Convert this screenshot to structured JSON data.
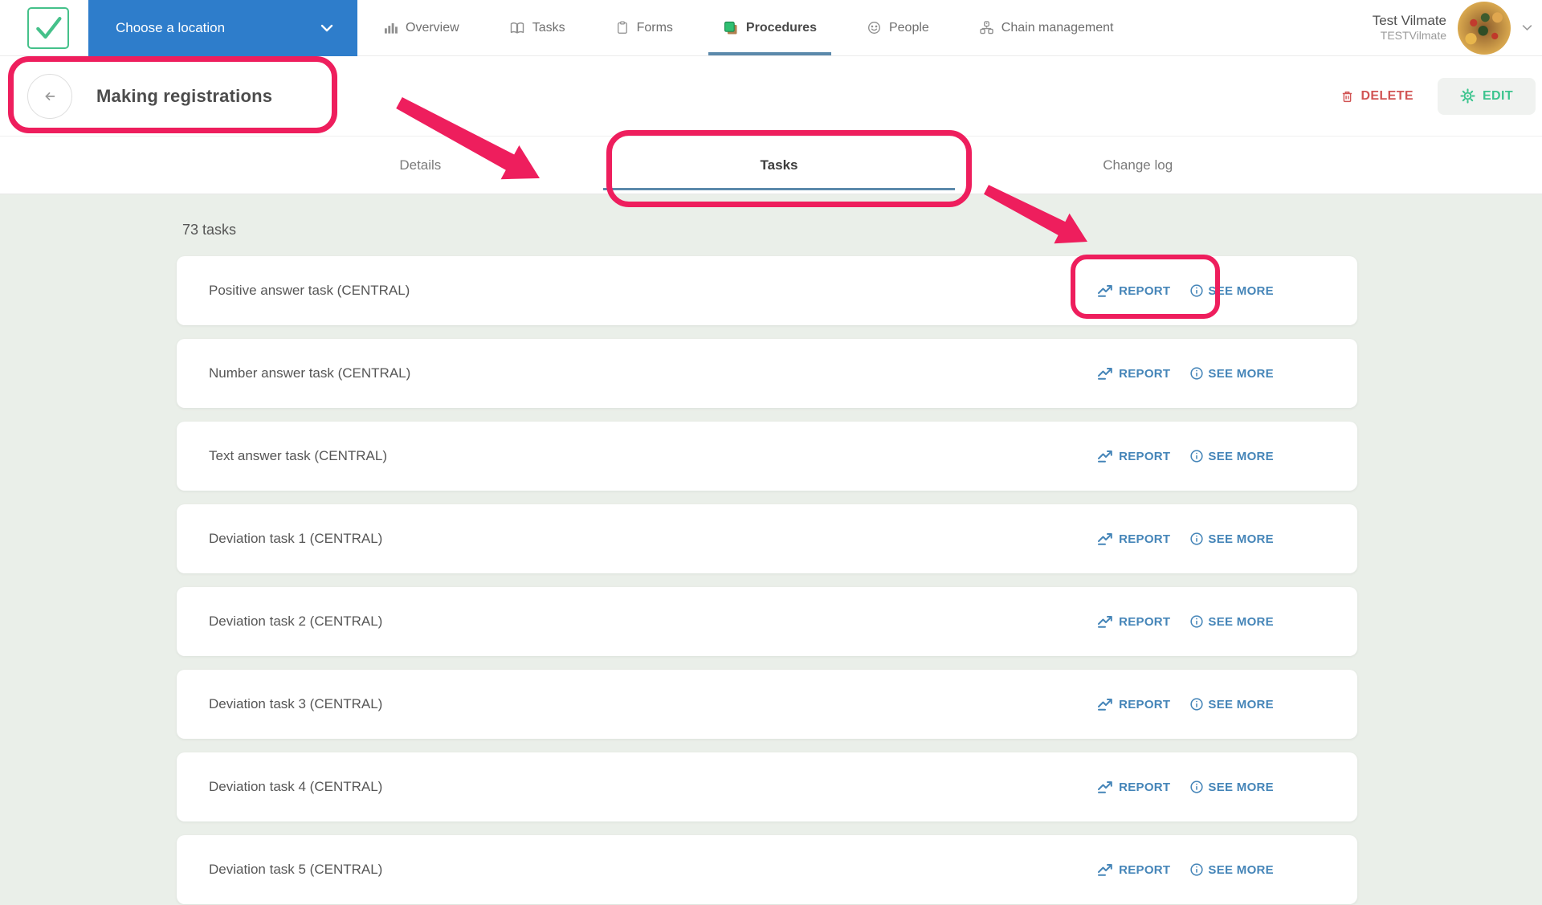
{
  "nav": {
    "location_button": {
      "label": "Choose a location"
    },
    "items": [
      {
        "label": "Overview",
        "icon": "bar-chart-icon",
        "active": false
      },
      {
        "label": "Tasks",
        "icon": "book-icon",
        "active": false
      },
      {
        "label": "Forms",
        "icon": "clipboard-icon",
        "active": false
      },
      {
        "label": "Procedures",
        "icon": "layers-icon",
        "active": true
      },
      {
        "label": "People",
        "icon": "smiley-icon",
        "active": false
      },
      {
        "label": "Chain management",
        "icon": "org-chart-icon",
        "active": false
      }
    ],
    "user": {
      "name": "Test Vilmate",
      "account": "TESTVilmate"
    }
  },
  "header": {
    "title": "Making registrations",
    "delete_label": "DELETE",
    "edit_label": "EDIT"
  },
  "tabs": [
    {
      "label": "Details",
      "active": false
    },
    {
      "label": "Tasks",
      "active": true
    },
    {
      "label": "Change log",
      "active": false
    }
  ],
  "content": {
    "count_label": "73 tasks",
    "task_actions": {
      "report": "REPORT",
      "see_more": "SEE MORE"
    },
    "tasks": [
      "Positive answer task (CENTRAL)",
      "Number answer task (CENTRAL)",
      "Text answer task (CENTRAL)",
      "Deviation task 1 (CENTRAL)",
      "Deviation task 2 (CENTRAL)",
      "Deviation task 3 (CENTRAL)",
      "Deviation task 4 (CENTRAL)",
      "Deviation task 5 (CENTRAL)"
    ]
  },
  "colors": {
    "accent-blue": "#2e7dcb",
    "underline-blue": "#5b89ab",
    "link-blue": "#4585b8",
    "annotation-pink": "#ee1e5d",
    "delete-red": "#d15454",
    "edit-green": "#3cc48e",
    "logo-green": "#45c18a",
    "content-bg": "#eaefe9"
  }
}
